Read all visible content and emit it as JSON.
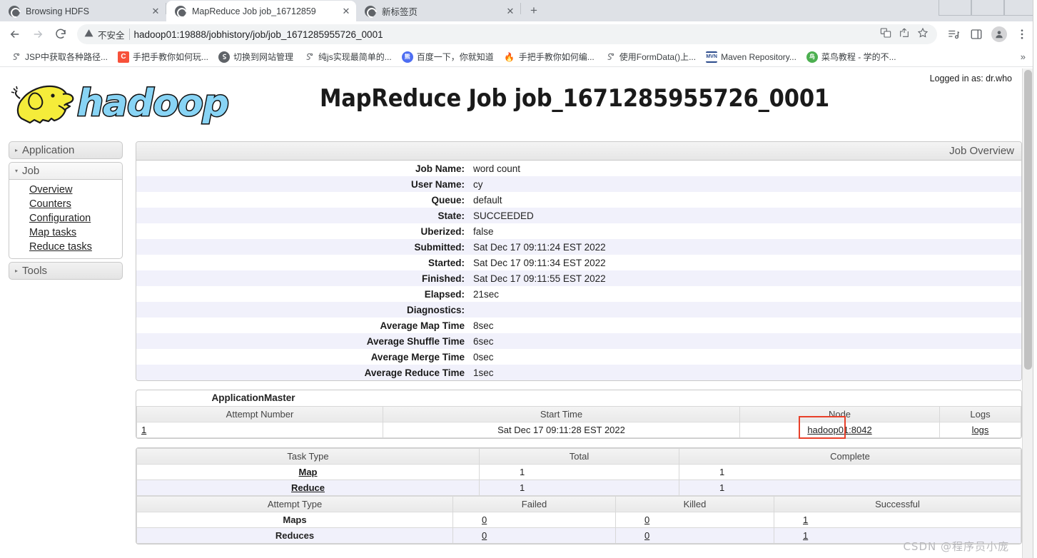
{
  "browser": {
    "tabs": [
      {
        "title": "Browsing HDFS",
        "icon": "globe-icon",
        "active": false
      },
      {
        "title": "MapReduce Job job_16712859",
        "icon": "globe-icon",
        "active": true
      },
      {
        "title": "新标签页",
        "icon": "globe-icon",
        "active": false
      }
    ],
    "new_tab_label": "+",
    "tab_list_chevron": "⌄",
    "nav": {
      "back": "←",
      "forward": "→",
      "reload": "⟳"
    },
    "omnibox": {
      "warning_icon": "warning-triangle-icon",
      "security_label": "不安全",
      "url": "hadoop01:19888/jobhistory/job/job_1671285955726_0001",
      "translate_icon": "translate-icon",
      "share_icon": "share-icon",
      "bookmark_icon": "star-icon"
    },
    "toolbar_right": {
      "reading_list_icon": "reading-list-icon",
      "side_panel_icon": "side-panel-icon",
      "profile_icon": "profile-avatar-icon",
      "menu_icon": "three-dot-menu-icon"
    },
    "bookmarks": [
      {
        "label": "JSP中获取各种路径...",
        "icon_text": "S",
        "icon_color": "#ffffff",
        "icon_bg": "transparent"
      },
      {
        "label": "手把手教你如何玩...",
        "icon_text": "C",
        "icon_color": "#ffffff",
        "icon_bg": "#f7513a"
      },
      {
        "label": "切换到网站管理",
        "icon_text": "",
        "icon_color": "#ffffff",
        "icon_bg": "#5f6368"
      },
      {
        "label": "纯js实现最简单的...",
        "icon_text": "S",
        "icon_color": "#ffffff",
        "icon_bg": "transparent"
      },
      {
        "label": "百度一下，你就知道",
        "icon_text": "熊",
        "icon_color": "#ffffff",
        "icon_bg": "#4e6ef2"
      },
      {
        "label": "手把手教你如何编...",
        "icon_text": "🔥",
        "icon_color": "#ffffff",
        "icon_bg": "transparent"
      },
      {
        "label": "使用FormData()上...",
        "icon_text": "S",
        "icon_color": "#ffffff",
        "icon_bg": "transparent"
      },
      {
        "label": "Maven Repository...",
        "icon_text": "MVN",
        "icon_color": "#2b4b8c",
        "icon_bg": "transparent"
      },
      {
        "label": "菜鸟教程 - 学的不...",
        "icon_text": "鸟",
        "icon_color": "#ffffff",
        "icon_bg": "#4caf50"
      }
    ],
    "bookmarks_overflow": "»"
  },
  "page": {
    "logged_in_as": "Logged in as: dr.who",
    "logo_alt": "hadoop",
    "title": "MapReduce Job job_1671285955726_0001",
    "sidebar": [
      {
        "label": "Application",
        "expanded": false,
        "arrow": "▸",
        "children": []
      },
      {
        "label": "Job",
        "expanded": true,
        "arrow": "▾",
        "children": [
          "Overview",
          "Counters",
          "Configuration",
          "Map tasks",
          "Reduce tasks"
        ]
      },
      {
        "label": "Tools",
        "expanded": false,
        "arrow": "▸",
        "children": []
      }
    ],
    "overview": {
      "caption": "Job Overview",
      "rows": [
        {
          "key": "Job Name:",
          "value": "word count"
        },
        {
          "key": "User Name:",
          "value": "cy"
        },
        {
          "key": "Queue:",
          "value": "default"
        },
        {
          "key": "State:",
          "value": "SUCCEEDED"
        },
        {
          "key": "Uberized:",
          "value": "false"
        },
        {
          "key": "Submitted:",
          "value": "Sat Dec 17 09:11:24 EST 2022"
        },
        {
          "key": "Started:",
          "value": "Sat Dec 17 09:11:34 EST 2022"
        },
        {
          "key": "Finished:",
          "value": "Sat Dec 17 09:11:55 EST 2022"
        },
        {
          "key": "Elapsed:",
          "value": "21sec"
        },
        {
          "key": "Diagnostics:",
          "value": ""
        },
        {
          "key": "Average Map Time",
          "value": "8sec"
        },
        {
          "key": "Average Shuffle Time",
          "value": "6sec"
        },
        {
          "key": "Average Merge Time",
          "value": "0sec"
        },
        {
          "key": "Average Reduce Time",
          "value": "1sec"
        }
      ]
    },
    "appmaster": {
      "title": "ApplicationMaster",
      "headers": [
        "Attempt Number",
        "Start Time",
        "Node",
        "Logs"
      ],
      "rows": [
        {
          "attempt": "1",
          "start_time": "Sat Dec 17 09:11:28 EST 2022",
          "node": "hadoop01:8042",
          "logs": "logs"
        }
      ],
      "highlight_color": "#e8402a"
    },
    "tasks": {
      "headers": [
        "Task Type",
        "Total",
        "Complete"
      ],
      "rows": [
        {
          "type": "Map",
          "total": "1",
          "complete": "1"
        },
        {
          "type": "Reduce",
          "total": "1",
          "complete": "1"
        }
      ],
      "attempt_headers": [
        "Attempt Type",
        "Failed",
        "Killed",
        "Successful"
      ],
      "attempt_rows": [
        {
          "type": "Maps",
          "failed": "0",
          "killed": "0",
          "successful": "1"
        },
        {
          "type": "Reduces",
          "failed": "0",
          "killed": "0",
          "successful": "1"
        }
      ]
    },
    "watermark": "CSDN @程序员小庞"
  }
}
